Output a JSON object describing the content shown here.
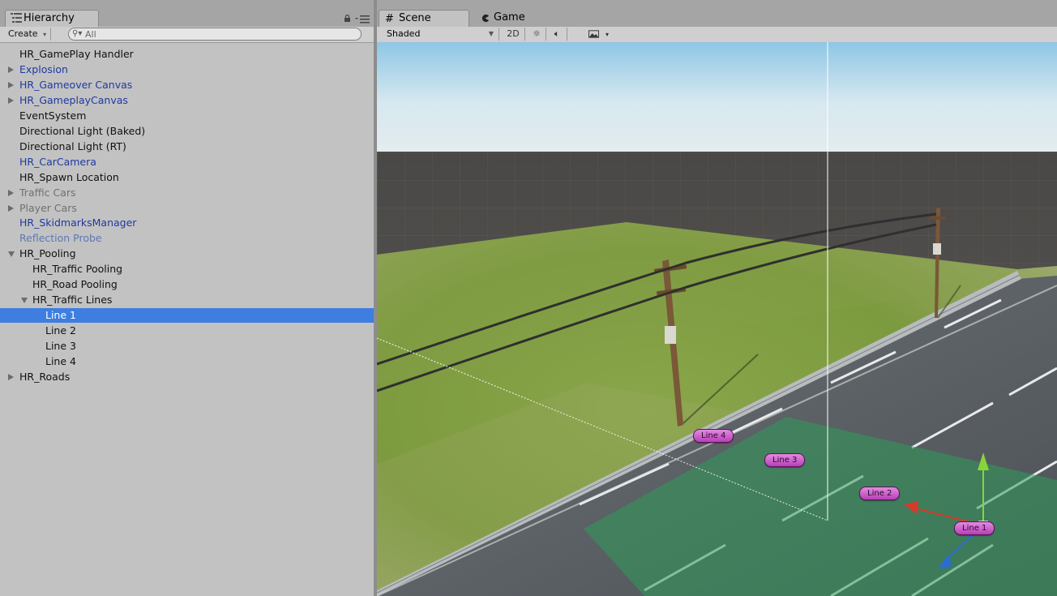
{
  "hierarchy": {
    "tab_label": "Hierarchy",
    "create_label": "Create",
    "search_placeholder": "All",
    "items": [
      {
        "label": "HR_GamePlay Handler",
        "color": "black",
        "arrow": "none",
        "indent": 0
      },
      {
        "label": "Explosion",
        "color": "blue",
        "arrow": "right",
        "indent": 0
      },
      {
        "label": "HR_Gameover Canvas",
        "color": "blue",
        "arrow": "right",
        "indent": 0
      },
      {
        "label": "HR_GameplayCanvas",
        "color": "blue",
        "arrow": "right",
        "indent": 0
      },
      {
        "label": "EventSystem",
        "color": "black",
        "arrow": "none",
        "indent": 0
      },
      {
        "label": "Directional Light (Baked)",
        "color": "black",
        "arrow": "none",
        "indent": 0
      },
      {
        "label": "Directional Light (RT)",
        "color": "black",
        "arrow": "none",
        "indent": 0
      },
      {
        "label": "HR_CarCamera",
        "color": "blue",
        "arrow": "none",
        "indent": 0
      },
      {
        "label": "HR_Spawn Location",
        "color": "black",
        "arrow": "none",
        "indent": 0
      },
      {
        "label": "Traffic Cars",
        "color": "gray",
        "arrow": "right",
        "indent": 0
      },
      {
        "label": "Player Cars",
        "color": "gray",
        "arrow": "right",
        "indent": 0
      },
      {
        "label": "HR_SkidmarksManager",
        "color": "blue",
        "arrow": "none",
        "indent": 0
      },
      {
        "label": "Reflection Probe",
        "color": "lightblue",
        "arrow": "none",
        "indent": 0
      },
      {
        "label": "HR_Pooling",
        "color": "black",
        "arrow": "down",
        "indent": 0
      },
      {
        "label": "HR_Traffic Pooling",
        "color": "black",
        "arrow": "none",
        "indent": 1
      },
      {
        "label": "HR_Road Pooling",
        "color": "black",
        "arrow": "none",
        "indent": 1
      },
      {
        "label": "HR_Traffic Lines",
        "color": "black",
        "arrow": "down",
        "indent": 1
      },
      {
        "label": "Line 1",
        "color": "black",
        "arrow": "none",
        "indent": 2,
        "selected": true
      },
      {
        "label": "Line 2",
        "color": "black",
        "arrow": "none",
        "indent": 2
      },
      {
        "label": "Line 3",
        "color": "black",
        "arrow": "none",
        "indent": 2
      },
      {
        "label": "Line 4",
        "color": "black",
        "arrow": "none",
        "indent": 2
      },
      {
        "label": "HR_Roads",
        "color": "black",
        "arrow": "right",
        "indent": 0
      }
    ]
  },
  "scene": {
    "tabs": [
      {
        "label": "Scene",
        "icon": "grid-icon",
        "active": true
      },
      {
        "label": "Game",
        "icon": "pacman-icon",
        "active": false
      }
    ],
    "shading_mode": "Shaded",
    "toggle_2d_label": "2D",
    "gizmo_labels": [
      "Line 4",
      "Line 3",
      "Line 2",
      "Line 1"
    ]
  },
  "colors": {
    "selection": "#3d7ee0",
    "prefab_blue": "#1e3aa0",
    "label_magenta": "#c456c4"
  }
}
